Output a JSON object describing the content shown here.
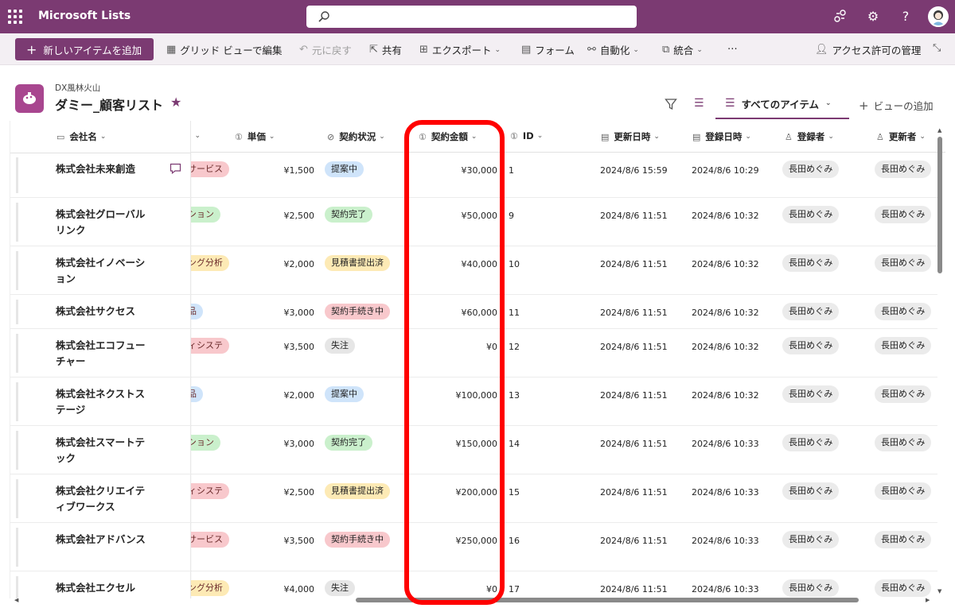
{
  "app": {
    "name": "Microsoft Lists"
  },
  "search": {
    "placeholder": ""
  },
  "commands": {
    "new_item": "新しいアイテムを追加",
    "grid_edit": "グリッド ビューで編集",
    "undo": "元に戻す",
    "share": "共有",
    "export": "エクスポート",
    "form": "フォーム",
    "automate": "自動化",
    "integrate": "統合",
    "more": "⋯",
    "access": "アクセス許可の管理"
  },
  "list": {
    "site": "DX風林火山",
    "title": "ダミー_顧客リスト"
  },
  "views": {
    "current": "すべてのアイテム",
    "add": "ビューの追加"
  },
  "columns": {
    "company": "会社名",
    "category": "…",
    "unit_price": "単価",
    "status": "契約状況",
    "amount": "契約金額",
    "id": "ID",
    "modified": "更新日時",
    "created": "登録日時",
    "author": "登録者",
    "editor": "更新者"
  },
  "colors": {
    "brand": "#7b3a72",
    "highlight": "#ff0000",
    "status_proposal": "#cfe4fa",
    "status_done": "#caf0cc",
    "status_quote": "#fdeab5",
    "status_procedure": "#f8c8cc",
    "status_lost": "#e6e6e6"
  },
  "rows": [
    {
      "company": "株式会社未来創造",
      "category": "サービス",
      "cat_color": "#f8c8cc",
      "unit_price": "¥1,500",
      "status": "提案中",
      "status_color": "#cfe4fa",
      "amount": "¥30,000",
      "id": "1",
      "modified": "2024/8/6 15:59",
      "created": "2024/8/6 10:29",
      "author": "長田めぐみ",
      "editor": "長田めぐみ"
    },
    {
      "company": "株式会社グローバルリンク",
      "category": "ション",
      "cat_color": "#caf0cc",
      "unit_price": "¥2,500",
      "status": "契約完了",
      "status_color": "#caf0cc",
      "amount": "¥50,000",
      "id": "9",
      "modified": "2024/8/6 11:51",
      "created": "2024/8/6 10:32",
      "author": "長田めぐみ",
      "editor": "長田めぐみ"
    },
    {
      "company": "株式会社イノベーション",
      "category": "ング分析",
      "cat_color": "#fdeab5",
      "unit_price": "¥2,000",
      "status": "見積書提出済",
      "status_color": "#fdeab5",
      "amount": "¥40,000",
      "id": "10",
      "modified": "2024/8/6 11:51",
      "created": "2024/8/6 10:32",
      "author": "長田めぐみ",
      "editor": "長田めぐみ"
    },
    {
      "company": "株式会社サクセス",
      "category": "品",
      "cat_color": "#cfe4fa",
      "unit_price": "¥3,000",
      "status": "契約手続き中",
      "status_color": "#f8c8cc",
      "amount": "¥60,000",
      "id": "11",
      "modified": "2024/8/6 11:51",
      "created": "2024/8/6 10:32",
      "author": "長田めぐみ",
      "editor": "長田めぐみ"
    },
    {
      "company": "株式会社エコフューチャー",
      "category": "ィシステ",
      "cat_color": "#f8c8cc",
      "unit_price": "¥3,500",
      "status": "失注",
      "status_color": "#e6e6e6",
      "amount": "¥0",
      "id": "12",
      "modified": "2024/8/6 11:51",
      "created": "2024/8/6 10:32",
      "author": "長田めぐみ",
      "editor": "長田めぐみ"
    },
    {
      "company": "株式会社ネクストステージ",
      "category": "品",
      "cat_color": "#cfe4fa",
      "unit_price": "¥2,000",
      "status": "提案中",
      "status_color": "#cfe4fa",
      "amount": "¥100,000",
      "id": "13",
      "modified": "2024/8/6 11:51",
      "created": "2024/8/6 10:32",
      "author": "長田めぐみ",
      "editor": "長田めぐみ"
    },
    {
      "company": "株式会社スマートテック",
      "category": "ション",
      "cat_color": "#caf0cc",
      "unit_price": "¥3,000",
      "status": "契約完了",
      "status_color": "#caf0cc",
      "amount": "¥150,000",
      "id": "14",
      "modified": "2024/8/6 11:51",
      "created": "2024/8/6 10:33",
      "author": "長田めぐみ",
      "editor": "長田めぐみ"
    },
    {
      "company": "株式会社クリエイティブワークス",
      "category": "ィシステ",
      "cat_color": "#f8c8cc",
      "unit_price": "¥2,500",
      "status": "見積書提出済",
      "status_color": "#fdeab5",
      "amount": "¥200,000",
      "id": "15",
      "modified": "2024/8/6 11:51",
      "created": "2024/8/6 10:33",
      "author": "長田めぐみ",
      "editor": "長田めぐみ"
    },
    {
      "company": "株式会社アドバンス",
      "category": "サービス",
      "cat_color": "#f8c8cc",
      "unit_price": "¥3,500",
      "status": "契約手続き中",
      "status_color": "#f8c8cc",
      "amount": "¥250,000",
      "id": "16",
      "modified": "2024/8/6 11:51",
      "created": "2024/8/6 10:33",
      "author": "長田めぐみ",
      "editor": "長田めぐみ"
    },
    {
      "company": "株式会社エクセル",
      "category": "ング分析",
      "cat_color": "#fdeab5",
      "unit_price": "¥4,000",
      "status": "失注",
      "status_color": "#e6e6e6",
      "amount": "¥0",
      "id": "17",
      "modified": "2024/8/6 11:51",
      "created": "2024/8/6 10:33",
      "author": "長田めぐみ",
      "editor": "長田めぐみ"
    }
  ]
}
